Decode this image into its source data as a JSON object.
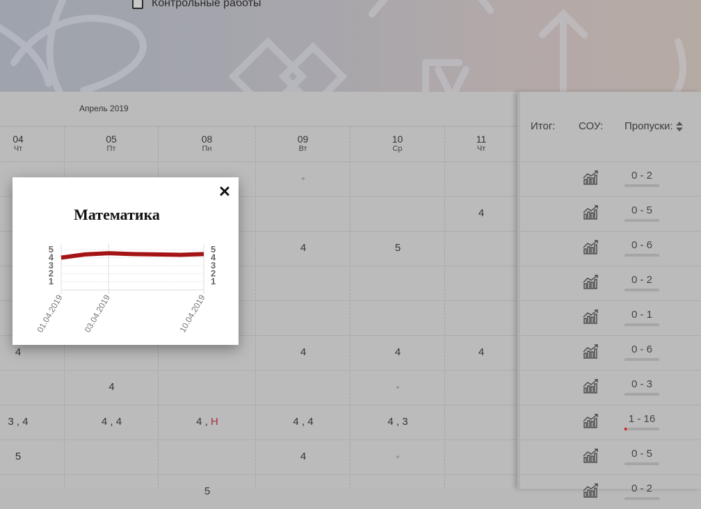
{
  "filter": {
    "label": "Контрольные работы",
    "checked": false
  },
  "grid": {
    "month": "Апрель 2019",
    "days": [
      {
        "num": "04",
        "weekday": "Чт"
      },
      {
        "num": "05",
        "weekday": "Пт"
      },
      {
        "num": "08",
        "weekday": "Пн"
      },
      {
        "num": "09",
        "weekday": "Вт"
      },
      {
        "num": "10",
        "weekday": "Ср"
      },
      {
        "num": "11",
        "weekday": "Чт"
      }
    ],
    "rows": [
      [
        "",
        "",
        "",
        "•",
        "",
        ""
      ],
      [
        "",
        "",
        "",
        "",
        "",
        "4"
      ],
      [
        "",
        "",
        "",
        "4",
        "5",
        ""
      ],
      [
        "",
        "",
        "",
        "",
        "",
        ""
      ],
      [
        "",
        "",
        "",
        "",
        "",
        ""
      ],
      [
        "4",
        "",
        "",
        "4",
        "4",
        "4"
      ],
      [
        "",
        "4",
        "",
        "",
        "•",
        ""
      ],
      [
        "3 , 4",
        "4 , 4",
        "4 , Н",
        "4 , 4",
        "4 , 3",
        ""
      ],
      [
        "5",
        "",
        "",
        "4",
        "•",
        ""
      ],
      [
        "",
        "",
        "5",
        "",
        "",
        ""
      ]
    ]
  },
  "right_panel": {
    "headers": {
      "itog": "Итог:",
      "sou": "СОУ:",
      "absences": "Пропуски:"
    },
    "rows": [
      {
        "absences": "0 - 2",
        "late_ratio": 0
      },
      {
        "absences": "0 - 5",
        "late_ratio": 0
      },
      {
        "absences": "0 - 6",
        "late_ratio": 0
      },
      {
        "absences": "0 - 2",
        "late_ratio": 0
      },
      {
        "absences": "0 - 1",
        "late_ratio": 0
      },
      {
        "absences": "0 - 6",
        "late_ratio": 0
      },
      {
        "absences": "0 - 3",
        "late_ratio": 0
      },
      {
        "absences": "1 - 16",
        "late_ratio": 0.06
      },
      {
        "absences": "0 - 5",
        "late_ratio": 0
      },
      {
        "absences": "0 - 2",
        "late_ratio": 0
      }
    ],
    "chart_icon": "chart-growth-icon"
  },
  "popup": {
    "title": "Математика",
    "close_icon": "close-icon",
    "chart_data": {
      "type": "line",
      "title": "Математика",
      "x": [
        "01.04.2019",
        "",
        "03.04.2019",
        "",
        "",
        "",
        "10.04.2019"
      ],
      "x_tick_labels": [
        "01.04.2019",
        "03.04.2019",
        "10.04.2019"
      ],
      "series": [
        {
          "values": [
            4.0,
            4.4,
            4.55,
            4.45,
            4.4,
            4.35,
            4.45
          ],
          "color": "#a51414"
        }
      ],
      "yticks": [
        "5",
        "4",
        "3",
        "2",
        "1"
      ],
      "ylim": [
        1,
        5
      ],
      "grid": true
    }
  }
}
